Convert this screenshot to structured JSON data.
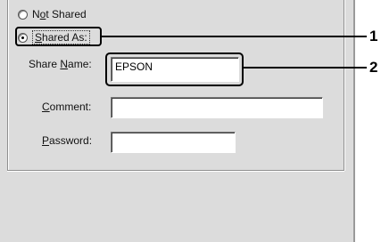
{
  "sharing": {
    "not_shared": {
      "label_mnemonic": "o",
      "label_pre": "N",
      "label_post": "t Shared",
      "checked": false
    },
    "shared_as": {
      "label_mnemonic": "S",
      "label_pre": "",
      "label_post": "hared As:",
      "checked": true
    }
  },
  "fields": {
    "share_name": {
      "label_pre": "Share ",
      "label_mnemonic": "N",
      "label_post": "ame:",
      "value": "EPSON"
    },
    "comment": {
      "label_pre": "",
      "label_mnemonic": "C",
      "label_post": "omment:",
      "value": ""
    },
    "password": {
      "label_pre": "",
      "label_mnemonic": "P",
      "label_post": "assword:",
      "value": ""
    }
  },
  "callouts": {
    "one": "1",
    "two": "2"
  }
}
